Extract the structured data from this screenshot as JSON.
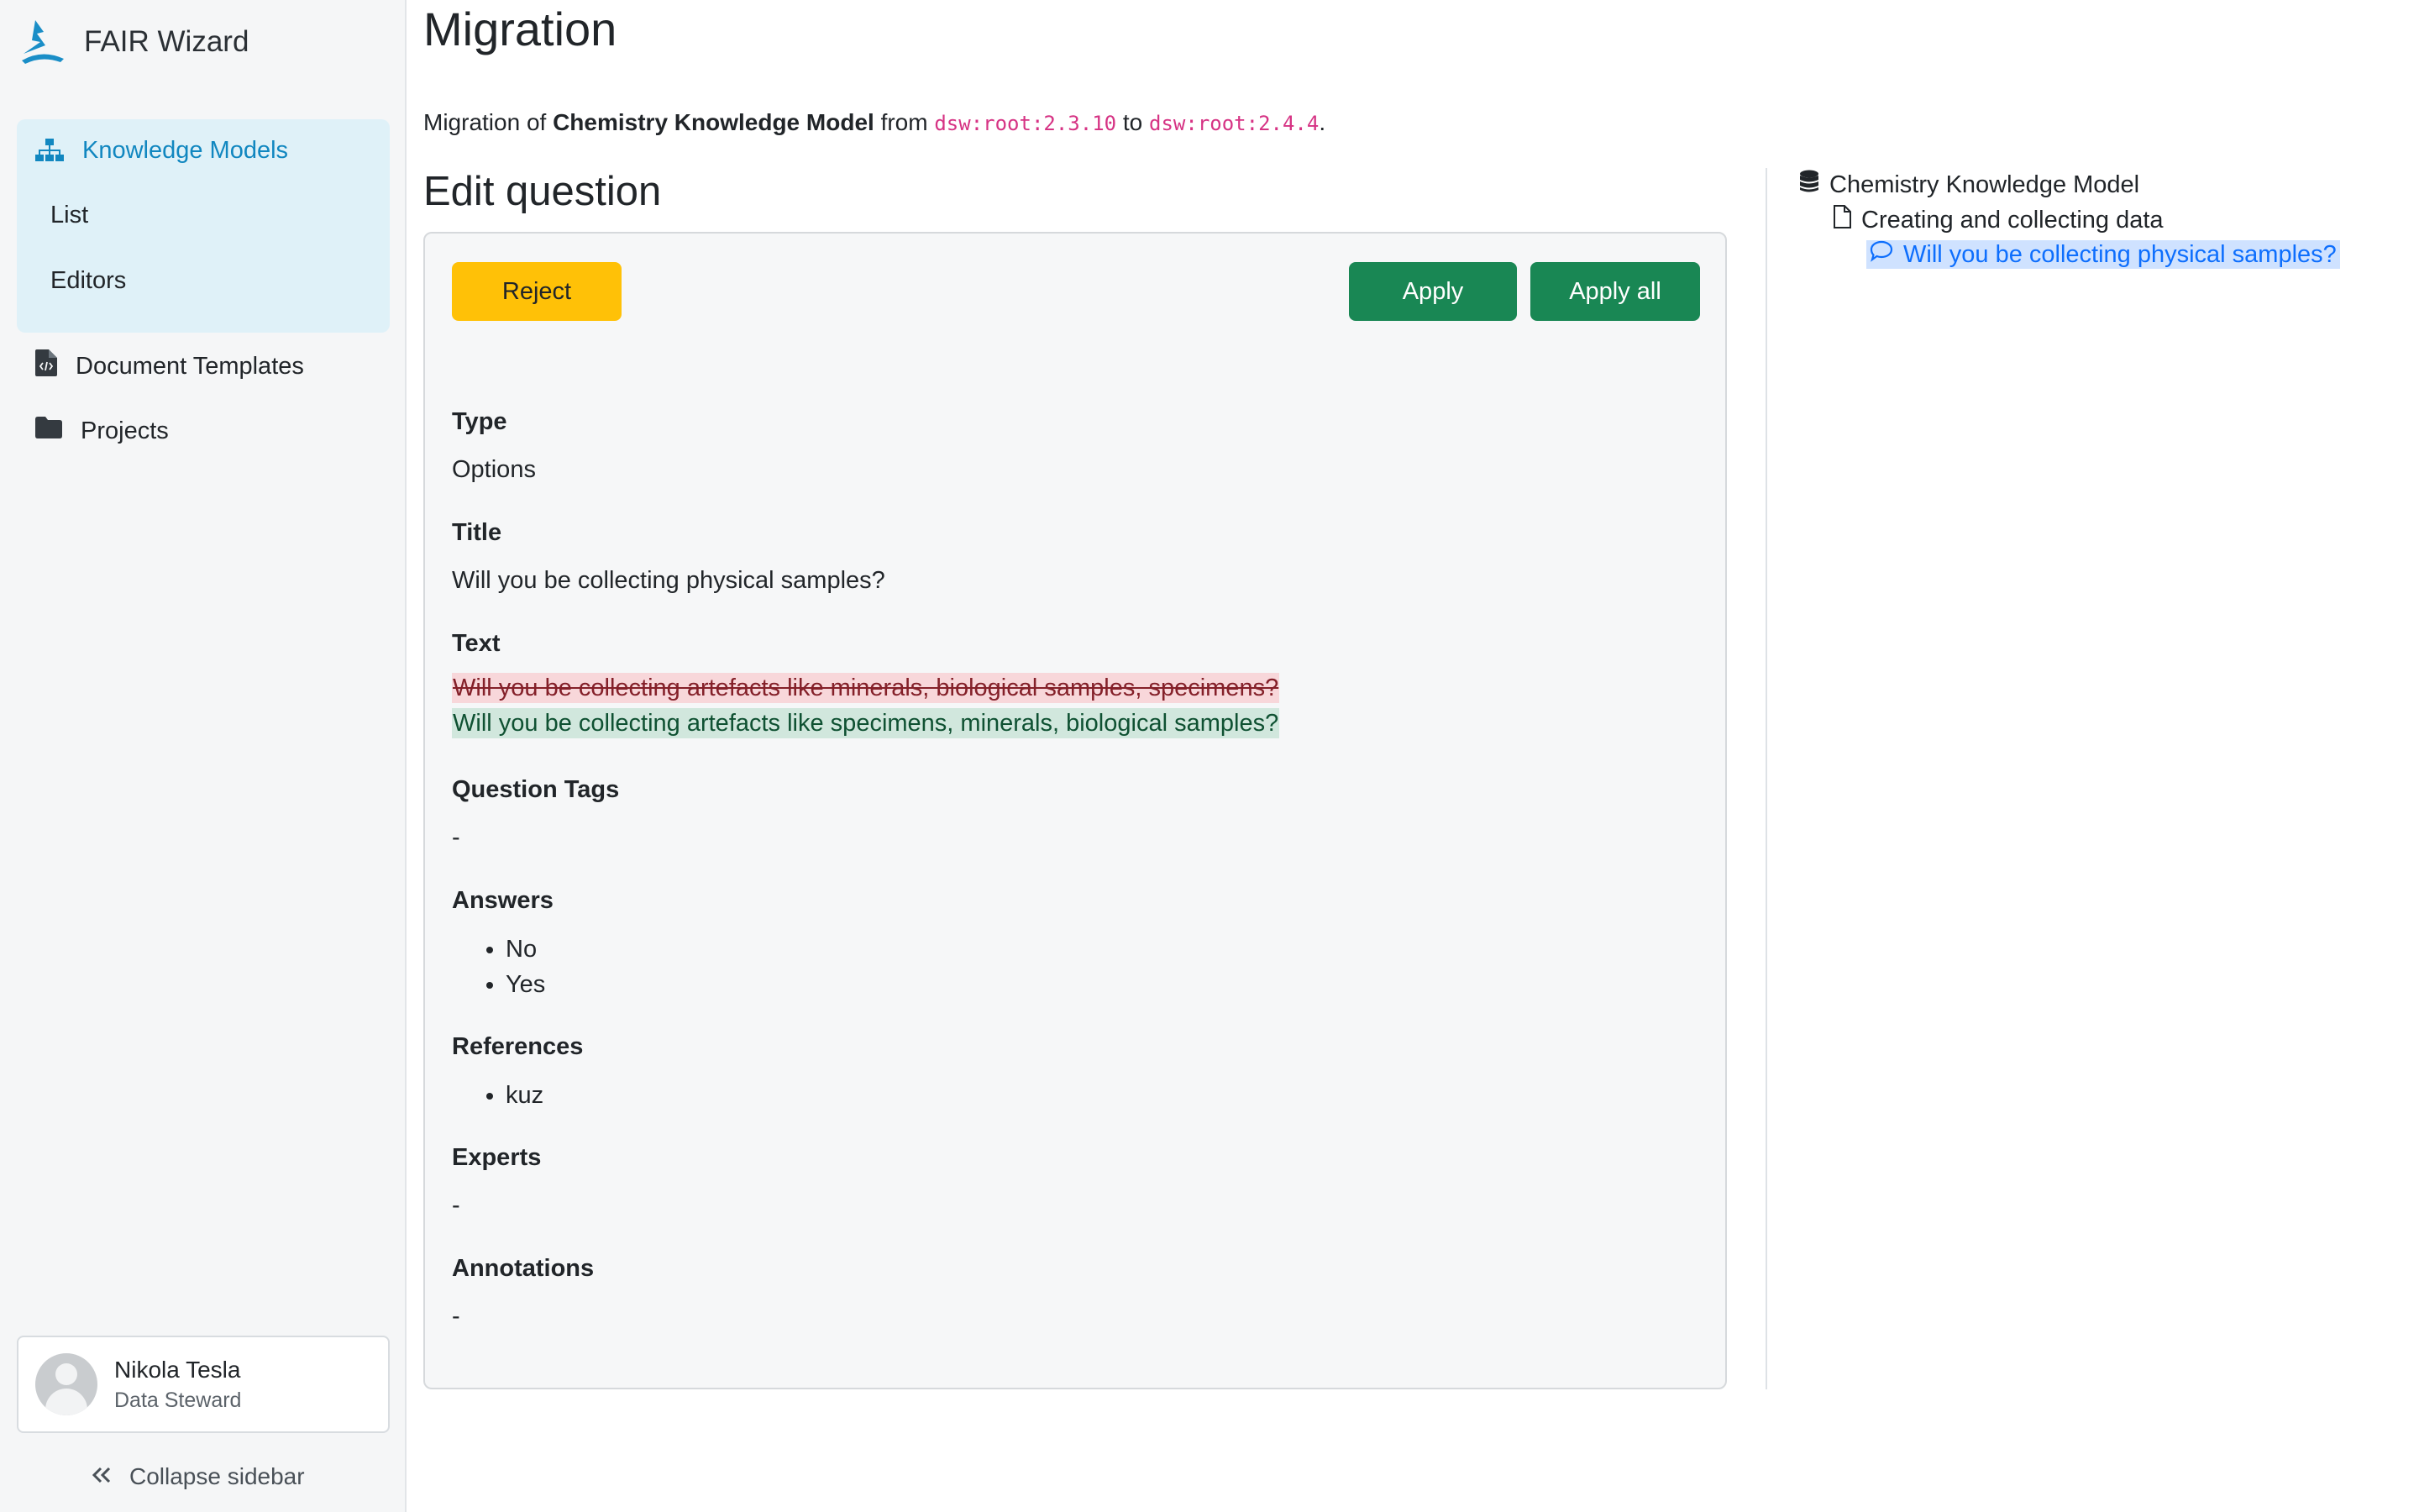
{
  "app": {
    "name": "FAIR Wizard"
  },
  "sidebar": {
    "knowledge_models": "Knowledge Models",
    "sub_list": "List",
    "sub_editors": "Editors",
    "document_templates": "Document Templates",
    "projects": "Projects",
    "user": {
      "name": "Nikola Tesla",
      "role": "Data Steward"
    },
    "collapse": "Collapse sidebar"
  },
  "page": {
    "title": "Migration",
    "migration": {
      "prefix": "Migration of ",
      "km_name": "Chemistry Knowledge Model",
      "from_word": " from ",
      "from_id": "dsw:root:2.3.10",
      "to_word": " to ",
      "to_id": "dsw:root:2.4.4",
      "suffix": "."
    },
    "section_title": "Edit question",
    "buttons": {
      "reject": "Reject",
      "apply": "Apply",
      "apply_all": "Apply all"
    },
    "fields": {
      "type_label": "Type",
      "type_value": "Options",
      "title_label": "Title",
      "title_value": "Will you be collecting physical samples?",
      "text_label": "Text",
      "text_old": "Will you be collecting artefacts like minerals, biological samples, specimens?",
      "text_new": "Will you be collecting artefacts like specimens, minerals, biological samples?",
      "tags_label": "Question Tags",
      "tags_value": "-",
      "answers_label": "Answers",
      "answers": [
        "No",
        "Yes"
      ],
      "references_label": "References",
      "references": [
        "kuz"
      ],
      "experts_label": "Experts",
      "experts_value": "-",
      "annotations_label": "Annotations",
      "annotations_value": "-"
    }
  },
  "tree": {
    "root": "Chemistry Knowledge Model",
    "chapter": "Creating and collecting data",
    "question": "Will you be collecting physical samples?"
  },
  "colors": {
    "accent": "#1187c0",
    "reject": "#ffc107",
    "apply": "#198754",
    "diff_removed_bg": "#f8d7da",
    "diff_added_bg": "#d1e7dd",
    "code": "#d63384"
  }
}
